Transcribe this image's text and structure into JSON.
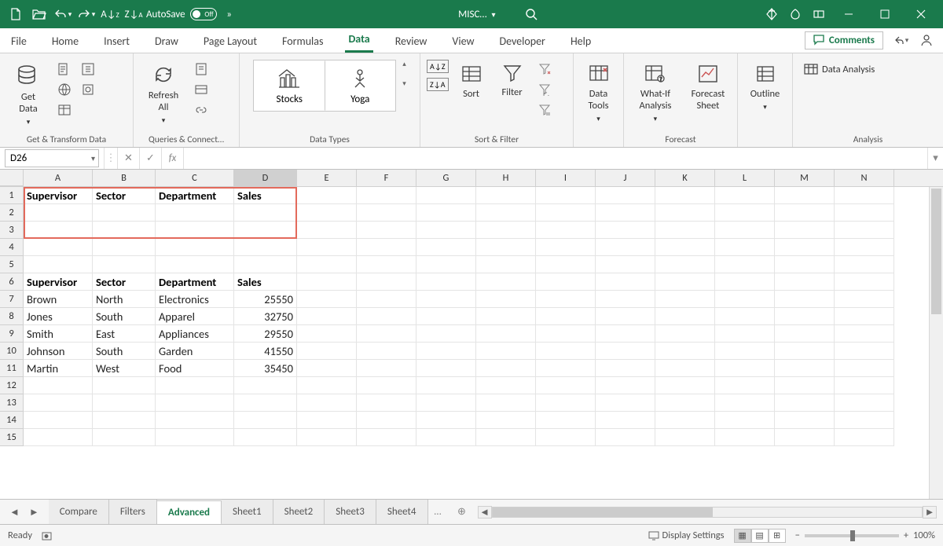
{
  "titlebar": {
    "autosave_label": "AutoSave",
    "autosave_state": "Off",
    "filename": "MISC…",
    "chevron": "»"
  },
  "tabs": {
    "file": "File",
    "home": "Home",
    "insert": "Insert",
    "draw": "Draw",
    "page_layout": "Page Layout",
    "formulas": "Formulas",
    "data": "Data",
    "review": "Review",
    "view": "View",
    "developer": "Developer",
    "help": "Help",
    "comments": "Comments"
  },
  "ribbon": {
    "get_data": "Get\nData",
    "refresh_all": "Refresh\nAll",
    "stocks": "Stocks",
    "yoga": "Yoga",
    "sort": "Sort",
    "filter": "Filter",
    "data_tools": "Data\nTools",
    "whatif": "What-If\nAnalysis",
    "forecast_sheet": "Forecast\nSheet",
    "outline": "Outline",
    "data_analysis": "Data Analysis",
    "groups": {
      "get_transform": "Get & Transform Data",
      "queries": "Queries & Connect…",
      "data_types": "Data Types",
      "sort_filter": "Sort & Filter",
      "forecast": "Forecast",
      "analysis": "Analysis"
    }
  },
  "name_box": "D26",
  "columns": [
    "A",
    "B",
    "C",
    "D",
    "E",
    "F",
    "G",
    "H",
    "I",
    "J",
    "K",
    "L",
    "M",
    "N"
  ],
  "rows": [
    "1",
    "2",
    "3",
    "4",
    "5",
    "6",
    "7",
    "8",
    "9",
    "10",
    "11",
    "12",
    "13",
    "14",
    "15"
  ],
  "headers": {
    "a": "Supervisor",
    "b": "Sector",
    "c": "Department",
    "d": "Sales"
  },
  "table": [
    {
      "a": "Brown",
      "b": "North",
      "c": "Electronics",
      "d": "25550"
    },
    {
      "a": "Jones",
      "b": "South",
      "c": "Apparel",
      "d": "32750"
    },
    {
      "a": "Smith",
      "b": "East",
      "c": "Appliances",
      "d": "29550"
    },
    {
      "a": "Johnson",
      "b": "South",
      "c": "Garden",
      "d": "41550"
    },
    {
      "a": "Martin",
      "b": "West",
      "c": "Food",
      "d": "35450"
    }
  ],
  "sheets": {
    "compare": "Compare",
    "filters": "Filters",
    "advanced": "Advanced",
    "sheet1": "Sheet1",
    "sheet2": "Sheet2",
    "sheet3": "Sheet3",
    "sheet4": "Sheet4"
  },
  "status": {
    "ready": "Ready",
    "display_settings": "Display Settings",
    "zoom": "100%"
  }
}
